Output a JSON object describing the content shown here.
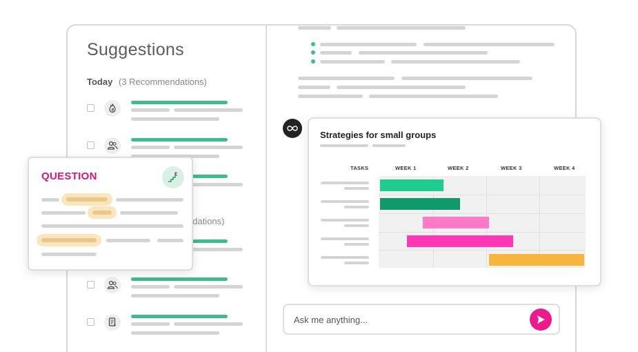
{
  "sidebar": {
    "title": "Suggestions",
    "today_label": "Today",
    "today_count": "(3 Recommendations)",
    "second_group_partial": "ndations)",
    "items": [
      {
        "icon": "fire-icon"
      },
      {
        "icon": "people-icon"
      },
      {
        "icon": "people-icon"
      },
      {
        "icon": "document-icon"
      }
    ]
  },
  "question_card": {
    "title": "QUESTION",
    "icon": "stairs-flag-icon"
  },
  "assistant": {
    "avatar_icon": "infinity-icon"
  },
  "gantt": {
    "title": "Strategies for small groups",
    "column_headers": [
      "TASKS",
      "WEEK 1",
      "WEEK 2",
      "WEEK 3",
      "WEEK 4"
    ]
  },
  "chart_data": {
    "type": "gantt",
    "title": "Strategies for small groups",
    "columns": [
      "WEEK 1",
      "WEEK 2",
      "WEEK 3",
      "WEEK 4"
    ],
    "tasks": [
      {
        "start_week": 1.0,
        "end_week": 2.2,
        "color": "#1fcc8f"
      },
      {
        "start_week": 1.0,
        "end_week": 2.5,
        "color": "#0e9a6a"
      },
      {
        "start_week": 1.8,
        "end_week": 3.05,
        "color": "#ff7ac6"
      },
      {
        "start_week": 1.5,
        "end_week": 3.5,
        "color": "#ff38b5"
      },
      {
        "start_week": 3.05,
        "end_week": 4.85,
        "color": "#f6b53c"
      }
    ]
  },
  "chat": {
    "placeholder": "Ask me anything..."
  },
  "colors": {
    "accent_green": "#3dbb8c",
    "accent_pink": "#ec1a8c",
    "question_pink": "#d4167f",
    "highlight_tan": "#fbe6bc"
  }
}
